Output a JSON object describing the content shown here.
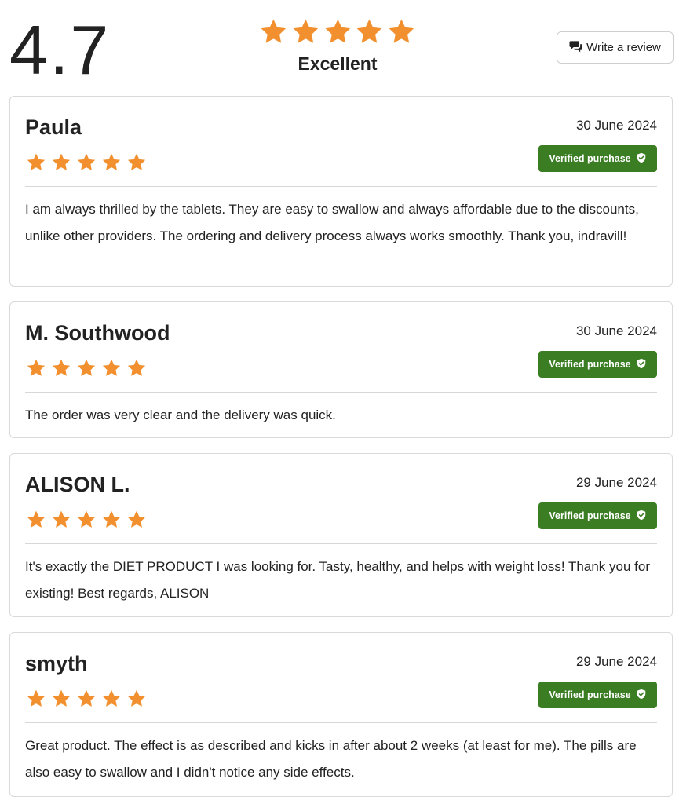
{
  "summary": {
    "score": "4.7",
    "stars": 5,
    "rating_label": "Excellent",
    "write_review_label": "Write a review"
  },
  "colors": {
    "star": "#f2902f",
    "badge": "#3b7d23",
    "border": "#d9d9d9"
  },
  "reviews": [
    {
      "name": "Paula",
      "date": "30 June 2024",
      "stars": 5,
      "badge": "Verified purchase",
      "text": "I am always thrilled by the tablets. They are easy to swallow and always affordable due to the discounts, unlike other providers. The ordering and delivery process always works smoothly. Thank you, indravill!"
    },
    {
      "name": "M. Southwood",
      "date": "30 June 2024",
      "stars": 5,
      "badge": "Verified purchase",
      "text": "The order was very clear and the delivery was quick."
    },
    {
      "name": "ALISON L.",
      "date": "29 June 2024",
      "stars": 5,
      "badge": "Verified purchase",
      "text": "It's exactly the DIET PRODUCT I was looking for. Tasty, healthy, and helps with weight loss! Thank you for existing! Best regards, ALISON"
    },
    {
      "name": "smyth",
      "date": "29 June 2024",
      "stars": 5,
      "badge": "Verified purchase",
      "text": "Great product. The effect is as described and kicks in after about 2 weeks (at least for me). The pills are also easy to swallow and I didn't notice any side effects."
    }
  ]
}
